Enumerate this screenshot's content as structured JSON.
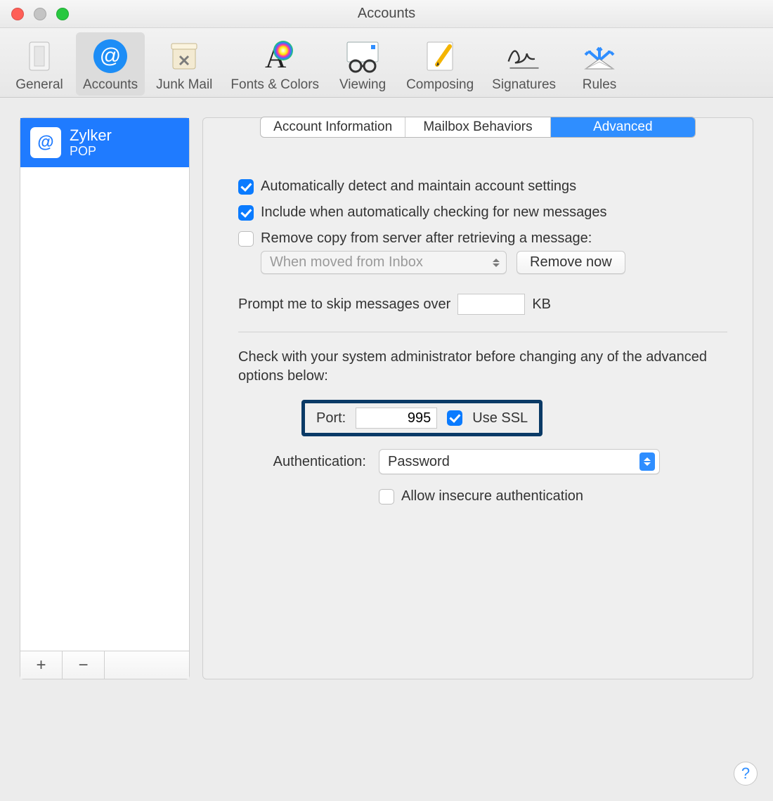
{
  "window": {
    "title": "Accounts"
  },
  "toolbar": {
    "items": [
      {
        "label": "General"
      },
      {
        "label": "Accounts"
      },
      {
        "label": "Junk Mail"
      },
      {
        "label": "Fonts & Colors"
      },
      {
        "label": "Viewing"
      },
      {
        "label": "Composing"
      },
      {
        "label": "Signatures"
      },
      {
        "label": "Rules"
      }
    ]
  },
  "sidebar": {
    "account": {
      "name": "Zylker",
      "type": "POP",
      "glyph": "@"
    },
    "add": "+",
    "remove": "−"
  },
  "tabs": {
    "info": "Account Information",
    "mailbox": "Mailbox Behaviors",
    "advanced": "Advanced"
  },
  "adv": {
    "auto_detect": "Automatically detect and maintain account settings",
    "include_check": "Include when automatically checking for new messages",
    "remove_copy": "Remove copy from server after retrieving a message:",
    "remove_when": "When moved from Inbox",
    "remove_now": "Remove now",
    "prompt_label_left": "Prompt me to skip messages over",
    "prompt_units": "KB",
    "admin_note": "Check with your system administrator before changing any of the advanced options below:",
    "port_label": "Port:",
    "port_value": "995",
    "use_ssl": "Use SSL",
    "auth_label": "Authentication:",
    "auth_value": "Password",
    "allow_insecure": "Allow insecure authentication"
  },
  "help": "?"
}
